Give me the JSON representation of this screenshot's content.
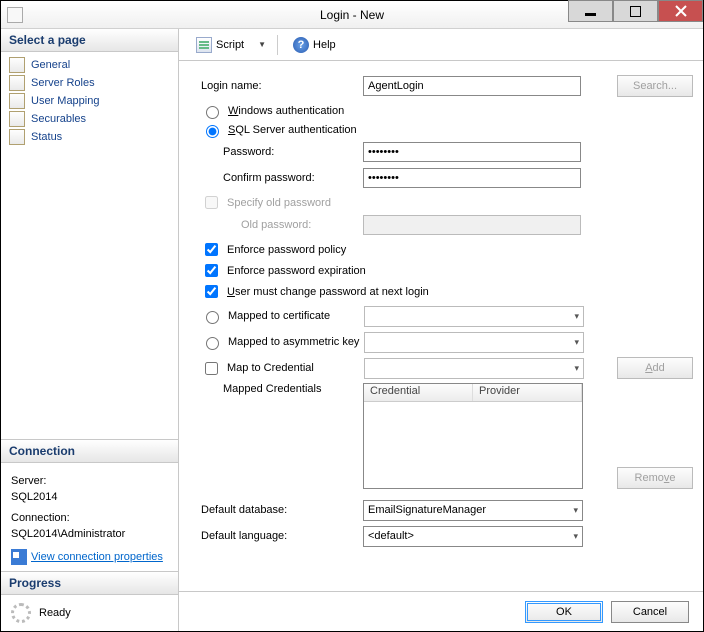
{
  "title": "Login - New",
  "sidebar": {
    "select_page": "Select a page",
    "items": [
      {
        "label": "General"
      },
      {
        "label": "Server Roles"
      },
      {
        "label": "User Mapping"
      },
      {
        "label": "Securables"
      },
      {
        "label": "Status"
      }
    ],
    "connection_title": "Connection",
    "server_label": "Server:",
    "server_value": "SQL2014",
    "connection_label": "Connection:",
    "connection_value": "SQL2014\\Administrator",
    "view_link": "View connection properties",
    "progress_title": "Progress",
    "progress_text": "Ready"
  },
  "toolbar": {
    "script": "Script",
    "help": "Help"
  },
  "form": {
    "login_name_label": "Login name:",
    "login_name_value": "AgentLogin",
    "search_btn": "Search...",
    "auth_windows": "Windows authentication",
    "auth_sql": "SQL Server authentication",
    "password_label": "Password:",
    "password_value": "••••••••",
    "confirm_label": "Confirm password:",
    "confirm_value": "••••••••",
    "specify_old": "Specify old password",
    "old_password_label": "Old password:",
    "enforce_policy": "Enforce password policy",
    "enforce_exp": "Enforce password expiration",
    "must_change": "User must change password at next login",
    "mapped_cert": "Mapped to certificate",
    "mapped_asym": "Mapped to asymmetric key",
    "map_cred": "Map to Credential",
    "add_btn": "Add",
    "mapped_credentials": "Mapped Credentials",
    "cred_col1": "Credential",
    "cred_col2": "Provider",
    "remove_btn": "Remove",
    "default_db_label": "Default database:",
    "default_db_value": "EmailSignatureManager",
    "default_lang_label": "Default language:",
    "default_lang_value": "<default>"
  },
  "footer": {
    "ok": "OK",
    "cancel": "Cancel"
  }
}
